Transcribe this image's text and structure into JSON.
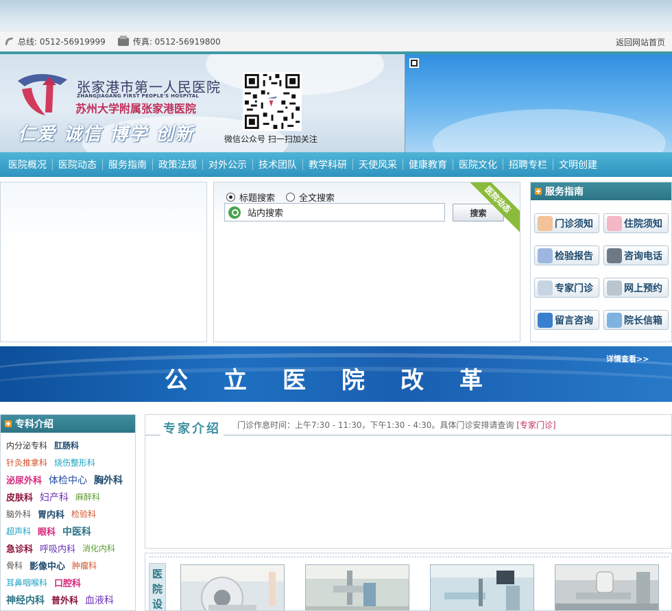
{
  "contact": {
    "phone": "总线: 0512-56919999",
    "fax": "传真: 0512-56919800",
    "home_link": "返回网站首页"
  },
  "header": {
    "name_cn": "张家港市第一人民医院",
    "name_en": "ZHANGJIAGANG FIRST PEOPLE'S HOSPITAL",
    "affiliation": "苏州大学附属张家港医院",
    "slogan": "仁爱 诚信 博学 创新",
    "qr_caption": "微信公众号 扫一扫加关注"
  },
  "nav": {
    "items": [
      "医院概况",
      "医院动态",
      "服务指南",
      "政策法规",
      "对外公示",
      "技术团队",
      "教学科研",
      "天使风采",
      "健康教育",
      "医院文化",
      "招聘专栏",
      "文明创建"
    ]
  },
  "search": {
    "option_title": "标题搜索",
    "option_fulltext": "全文搜索",
    "input_value": "站内搜索",
    "button": "搜索",
    "ribbon": "医院动态"
  },
  "service": {
    "title": "服务指南",
    "items": [
      {
        "label": "门诊须知",
        "icon": "doctor-icon",
        "color": "#f2c29a"
      },
      {
        "label": "住院须知",
        "icon": "nurse-icon",
        "color": "#f5b7c5"
      },
      {
        "label": "检验报告",
        "icon": "report-icon",
        "color": "#9db7e0"
      },
      {
        "label": "咨询电话",
        "icon": "telephone-icon",
        "color": "#6d7a86"
      },
      {
        "label": "专家门诊",
        "icon": "expert-icon",
        "color": "#c7d4e3"
      },
      {
        "label": "网上预约",
        "icon": "mouse-icon",
        "color": "#b9c5cf"
      },
      {
        "label": "留言咨询",
        "icon": "monitor-icon",
        "color": "#3a7fcf"
      },
      {
        "label": "院长信箱",
        "icon": "mail-icon",
        "color": "#7fb2e0"
      }
    ]
  },
  "banner": {
    "title": "公立医院改革",
    "more": "详情查看>>"
  },
  "departments": {
    "title": "专科介绍",
    "rows": [
      [
        {
          "t": "内分泌专科",
          "c": "#333",
          "b": false,
          "s": 12
        },
        {
          "t": "肛肠科",
          "c": "#1f4a6e",
          "b": true,
          "s": 12
        }
      ],
      [
        {
          "t": "针灸推拿科",
          "c": "#d2522b",
          "b": false,
          "s": 12
        },
        {
          "t": "烧伤整形科",
          "c": "#18a3c4",
          "b": false,
          "s": 12
        }
      ],
      [
        {
          "t": "泌尿外科",
          "c": "#d6277c",
          "b": true,
          "s": 13
        },
        {
          "t": "体检中心",
          "c": "#1f4aa0",
          "b": false,
          "s": 14
        },
        {
          "t": "胸外科",
          "c": "#1f4a6e",
          "b": true,
          "s": 14
        }
      ],
      [
        {
          "t": "皮肤科",
          "c": "#8a1238",
          "b": true,
          "s": 13
        },
        {
          "t": "妇产科",
          "c": "#6b2fb5",
          "b": false,
          "s": 14
        },
        {
          "t": "麻醉科",
          "c": "#5a9a2e",
          "b": false,
          "s": 12
        }
      ],
      [
        {
          "t": "脑外科",
          "c": "#555",
          "b": false,
          "s": 12
        },
        {
          "t": "胃内科",
          "c": "#1f4a6e",
          "b": true,
          "s": 13
        },
        {
          "t": "检验科",
          "c": "#d2522b",
          "b": false,
          "s": 12
        }
      ],
      [
        {
          "t": "超声科",
          "c": "#18a3c4",
          "b": false,
          "s": 12
        },
        {
          "t": "眼科",
          "c": "#d6277c",
          "b": true,
          "s": 13
        },
        {
          "t": "中医科",
          "c": "#2d7587",
          "b": true,
          "s": 14
        }
      ],
      [
        {
          "t": "急诊科",
          "c": "#8a1238",
          "b": true,
          "s": 13
        },
        {
          "t": "呼吸内科",
          "c": "#6b2fb5",
          "b": false,
          "s": 13
        },
        {
          "t": "消化内科",
          "c": "#5a9a2e",
          "b": false,
          "s": 12
        }
      ],
      [
        {
          "t": "骨科",
          "c": "#555",
          "b": false,
          "s": 12
        },
        {
          "t": "影像中心",
          "c": "#1f4a6e",
          "b": true,
          "s": 13
        },
        {
          "t": "肿瘤科",
          "c": "#d2522b",
          "b": false,
          "s": 12
        }
      ],
      [
        {
          "t": "耳鼻咽喉科",
          "c": "#18a3c4",
          "b": false,
          "s": 12
        },
        {
          "t": "口腔科",
          "c": "#d6277c",
          "b": true,
          "s": 13
        }
      ],
      [
        {
          "t": "神经内科",
          "c": "#2d7587",
          "b": true,
          "s": 14
        },
        {
          "t": "普外科",
          "c": "#8a1238",
          "b": true,
          "s": 13
        },
        {
          "t": "血液科",
          "c": "#6b2fb5",
          "b": false,
          "s": 14
        }
      ]
    ]
  },
  "experts": {
    "title": "专家介绍",
    "note": "门诊作息时间：上午7:30 - 11:30，下午1:30 - 4:30。具体门诊安排请查询",
    "link": "[专家门诊]"
  },
  "facilities": {
    "label": "医院设备"
  }
}
